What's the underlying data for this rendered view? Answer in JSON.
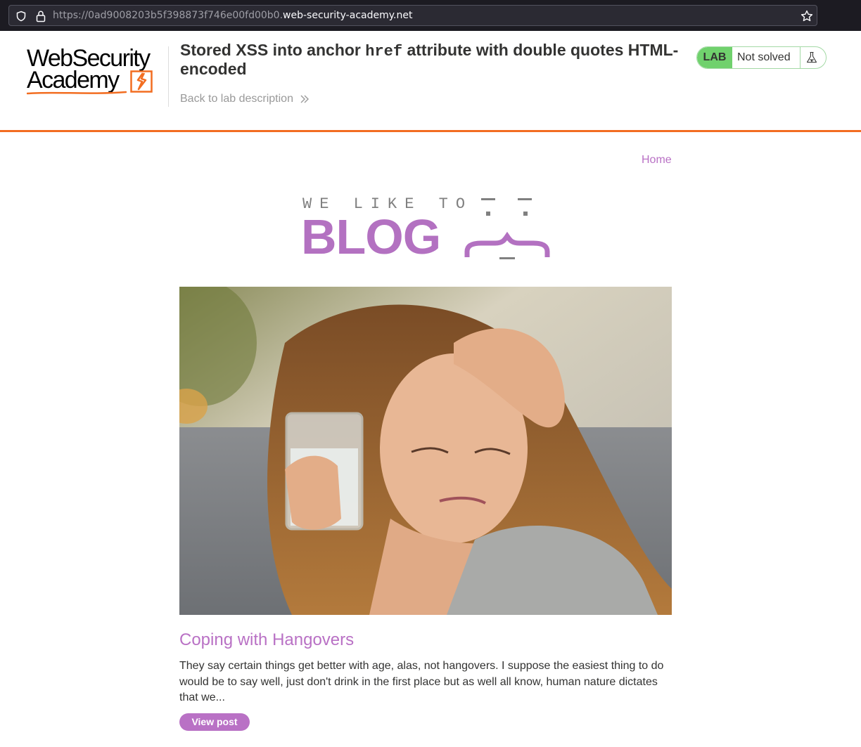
{
  "browser": {
    "url_prefix": "https://0ad9008203b5f398873f746e00fd00b0.",
    "url_host": "web-security-academy.net"
  },
  "academy": {
    "logo_line1": "WebSecurity",
    "logo_line2": "Academy",
    "lab_title_before": "Stored XSS into anchor ",
    "lab_title_code": "href",
    "lab_title_after": " attribute with double quotes HTML-encoded",
    "back_link": "Back to lab description",
    "status_badge": "LAB",
    "status_text": "Not solved",
    "accent_color": "#f26d21",
    "status_color": "#70d16d"
  },
  "blog": {
    "nav_home": "Home",
    "banner_tagline": "WE LIKE TO",
    "banner_word": "BLOG",
    "accent_color": "#b971c5",
    "posts": [
      {
        "title": "Coping with Hangovers",
        "excerpt": "They say certain things get better with age, alas, not hangovers. I suppose the easiest thing to do would be to say well, just don't drink in the first place but as well all know, human nature dictates that we...",
        "button_label": "View post"
      }
    ]
  },
  "icons": [
    "shield-icon",
    "lock-icon",
    "star-icon",
    "chevrons-right-icon",
    "flask-icon",
    "academy-logo-mark-icon"
  ]
}
